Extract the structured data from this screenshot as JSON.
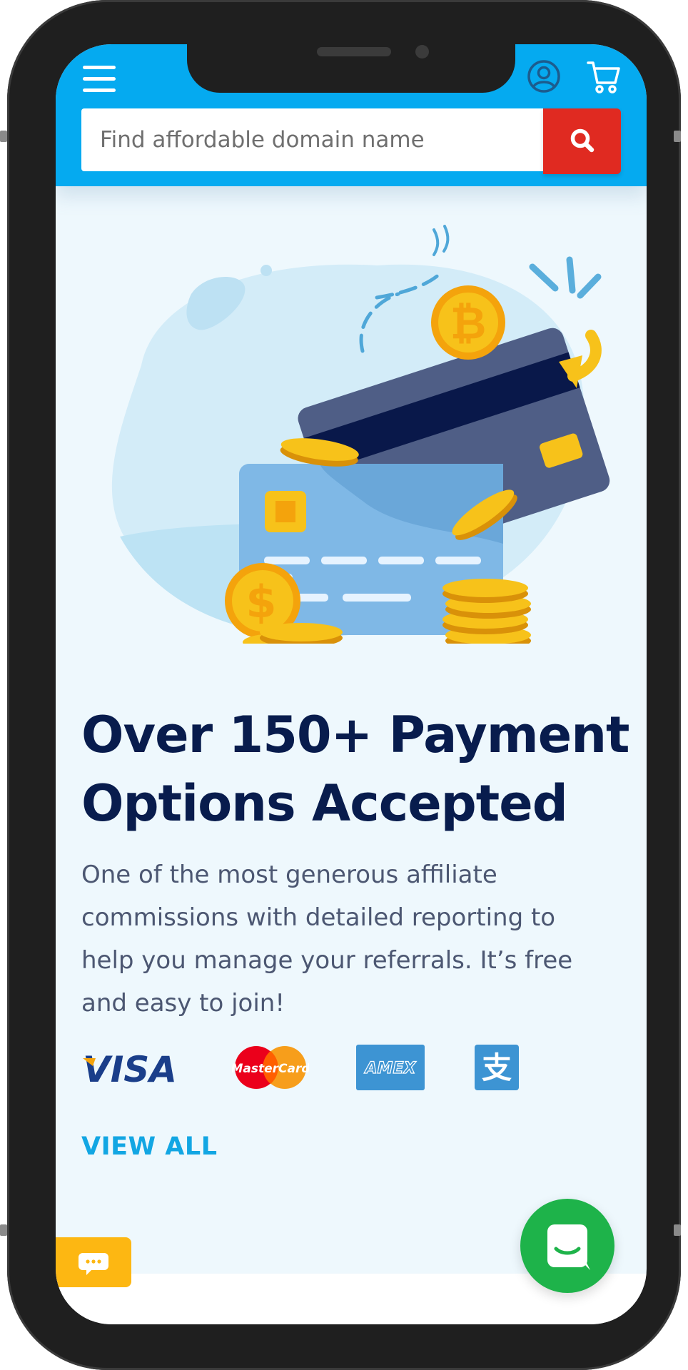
{
  "header": {
    "search": {
      "placeholder": "Find affordable domain name"
    },
    "icons": [
      "menu-icon",
      "account-icon",
      "cart-icon",
      "search-icon"
    ]
  },
  "hero": {
    "illustration": "credit-cards-and-coins-illustration",
    "headline": "Over 150+ Payment Options Accepted",
    "description": "One of the most generous affiliate commissions with detailed reporting to help you manage your referrals. It’s free and easy to join!",
    "payment_logos": [
      {
        "name": "VISA"
      },
      {
        "name": "MasterCard"
      },
      {
        "name": "AMEX"
      },
      {
        "name": "支"
      }
    ],
    "view_all_label": "VIEW ALL"
  },
  "widgets": {
    "feedback_icon": "speech-bubble-icon",
    "chat_icon": "chat-icon"
  },
  "colors": {
    "header": "#05aaf0",
    "search_button": "#e02a21",
    "headline": "#081c4d",
    "body_text": "#4c5772",
    "link": "#12a6e3",
    "feedback": "#fdb712",
    "chat": "#1eb34a",
    "page_bg": "#eef8fd"
  }
}
